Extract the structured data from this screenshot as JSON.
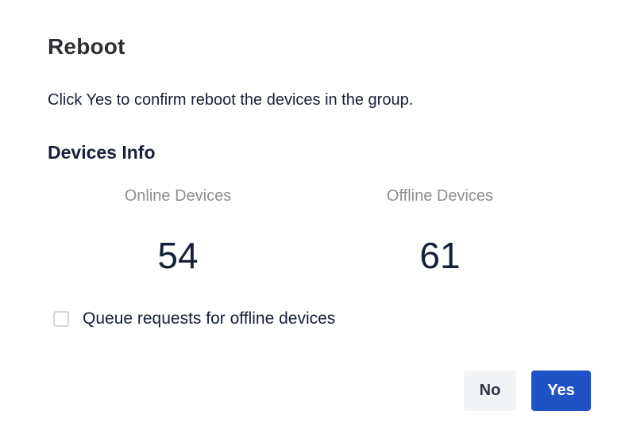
{
  "dialog": {
    "title": "Reboot",
    "message": "Click Yes to confirm reboot the devices in the group.",
    "section_title": "Devices Info",
    "online": {
      "label": "Online Devices",
      "value": "54"
    },
    "offline": {
      "label": "Offline Devices",
      "value": "61"
    },
    "queue_checkbox": {
      "label": "Queue requests for offline devices",
      "checked": false
    },
    "buttons": {
      "no_label": "No",
      "yes_label": "Yes"
    }
  },
  "colors": {
    "primary": "#1f52c4",
    "text_dark": "#17203a",
    "text_muted": "#8e8e93",
    "secondary_button_bg": "#f2f3f5"
  }
}
